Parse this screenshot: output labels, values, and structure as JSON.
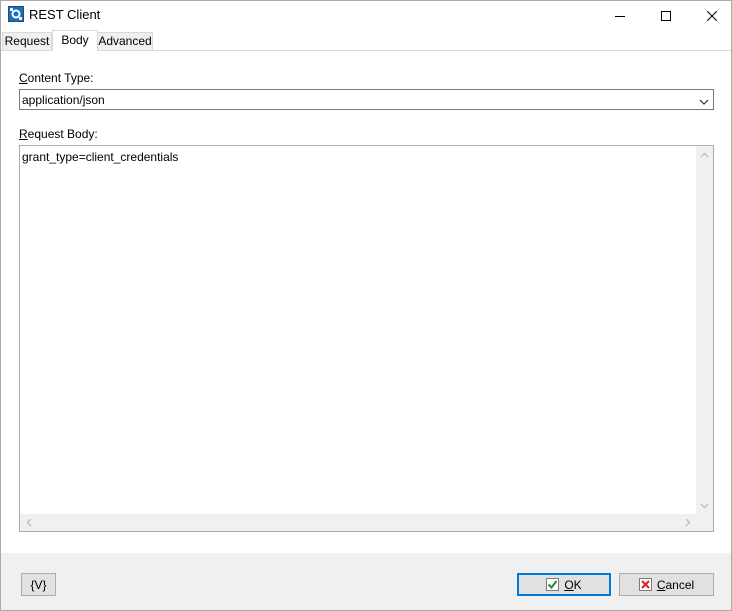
{
  "window": {
    "title": "REST Client",
    "app_icon": "rest-client-app-icon",
    "controls": {
      "minimize_icon": "minimize-icon",
      "maximize_icon": "maximize-icon",
      "close_icon": "close-icon"
    }
  },
  "tabs": [
    {
      "label": "Request",
      "selected": false
    },
    {
      "label": "Body",
      "selected": true
    },
    {
      "label": "Advanced",
      "selected": false
    }
  ],
  "body_tab": {
    "content_type": {
      "label_mnemonic": "C",
      "label_rest": "ontent Type:",
      "selected_value": "application/json"
    },
    "request_body": {
      "label_mnemonic": "R",
      "label_rest": "equest Body:",
      "value": "grant_type=client_credentials"
    }
  },
  "footer": {
    "variables_button": "{V}",
    "ok_button": {
      "mnemonic": "O",
      "rest": "K",
      "icon": "checkmark-icon",
      "accent": "#0078d7"
    },
    "cancel_button": {
      "mnemonic": "C",
      "rest": "ancel",
      "icon": "red-x-icon",
      "icon_color": "#d9261c"
    }
  }
}
